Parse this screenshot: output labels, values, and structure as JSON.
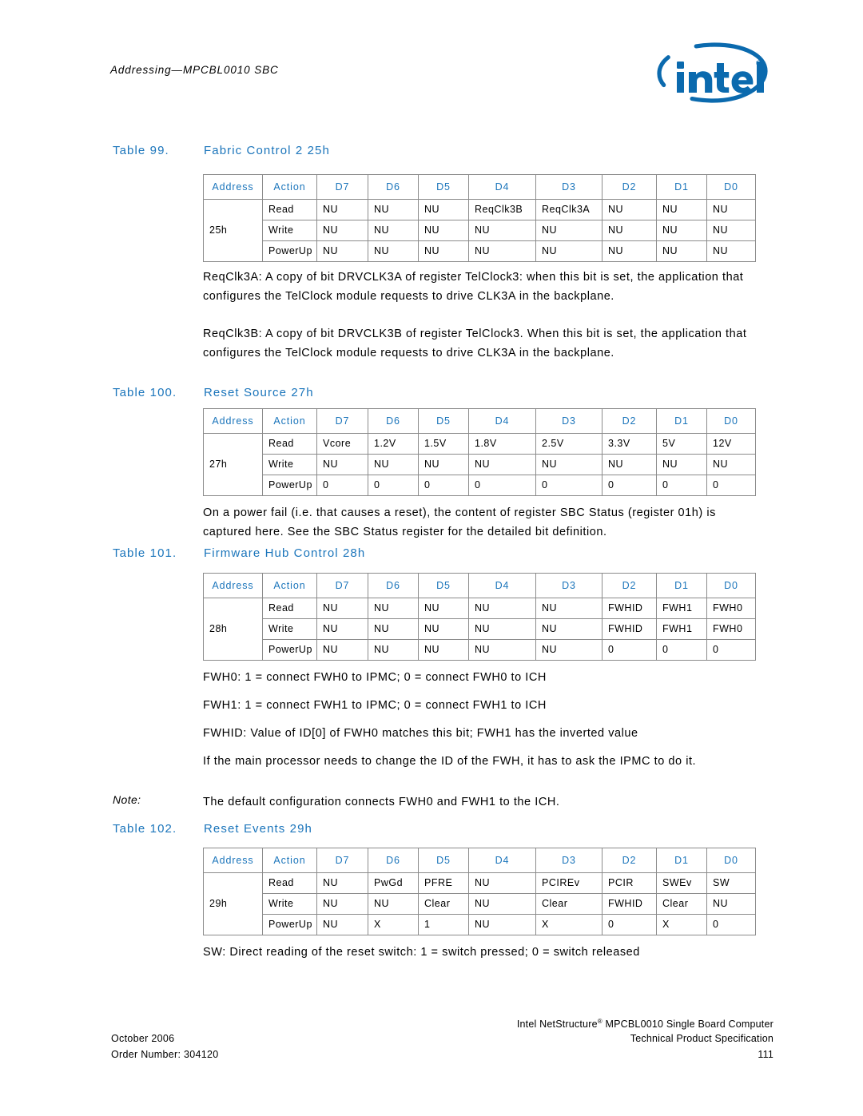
{
  "header": {
    "running_head": "Addressing—MPCBL0010 SBC",
    "logo_name": "intel",
    "logo_registered": "®",
    "logo_color": "#0B6AAE"
  },
  "theme": {
    "accent": "#1B75BB",
    "rule": "#8b8b8b",
    "text": "#000000"
  },
  "tables": [
    {
      "number": "Table 99.",
      "title": "Fabric Control 2 25h",
      "columns": [
        "Address",
        "Action",
        "D7",
        "D6",
        "D5",
        "D4",
        "D3",
        "D2",
        "D1",
        "D0"
      ],
      "address": "25h",
      "rows": [
        {
          "action": "Read",
          "bits": [
            "NU",
            "NU",
            "NU",
            "ReqClk3B",
            "ReqClk3A",
            "NU",
            "NU",
            "NU"
          ]
        },
        {
          "action": "Write",
          "bits": [
            "NU",
            "NU",
            "NU",
            "NU",
            "NU",
            "NU",
            "NU",
            "NU"
          ]
        },
        {
          "action": "PowerUp",
          "bits": [
            "NU",
            "NU",
            "NU",
            "NU",
            "NU",
            "NU",
            "NU",
            "NU"
          ]
        }
      ]
    },
    {
      "number": "Table 100.",
      "title": "Reset Source 27h",
      "columns": [
        "Address",
        "Action",
        "D7",
        "D6",
        "D5",
        "D4",
        "D3",
        "D2",
        "D1",
        "D0"
      ],
      "address": "27h",
      "rows": [
        {
          "action": "Read",
          "bits": [
            "Vcore",
            "1.2V",
            "1.5V",
            "1.8V",
            "2.5V",
            "3.3V",
            "5V",
            "12V"
          ]
        },
        {
          "action": "Write",
          "bits": [
            "NU",
            "NU",
            "NU",
            "NU",
            "NU",
            "NU",
            "NU",
            "NU"
          ]
        },
        {
          "action": "PowerUp",
          "bits": [
            "0",
            "0",
            "0",
            "0",
            "0",
            "0",
            "0",
            "0"
          ]
        }
      ]
    },
    {
      "number": "Table 101.",
      "title": "Firmware Hub Control 28h",
      "columns": [
        "Address",
        "Action",
        "D7",
        "D6",
        "D5",
        "D4",
        "D3",
        "D2",
        "D1",
        "D0"
      ],
      "address": "28h",
      "rows": [
        {
          "action": "Read",
          "bits": [
            "NU",
            "NU",
            "NU",
            "NU",
            "NU",
            "FWHID",
            "FWH1",
            "FWH0"
          ]
        },
        {
          "action": "Write",
          "bits": [
            "NU",
            "NU",
            "NU",
            "NU",
            "NU",
            "FWHID",
            "FWH1",
            "FWH0"
          ]
        },
        {
          "action": "PowerUp",
          "bits": [
            "NU",
            "NU",
            "NU",
            "NU",
            "NU",
            "0",
            "0",
            "0"
          ]
        }
      ]
    },
    {
      "number": "Table 102.",
      "title": "Reset Events 29h",
      "columns": [
        "Address",
        "Action",
        "D7",
        "D6",
        "D5",
        "D4",
        "D3",
        "D2",
        "D1",
        "D0"
      ],
      "address": "29h",
      "rows": [
        {
          "action": "Read",
          "bits": [
            "NU",
            "PwGd",
            "PFRE",
            "NU",
            "PCIREv",
            "PCIR",
            "SWEv",
            "SW"
          ]
        },
        {
          "action": "Write",
          "bits": [
            "NU",
            "NU",
            "Clear",
            "NU",
            "Clear",
            "FWHID",
            "Clear",
            "NU"
          ]
        },
        {
          "action": "PowerUp",
          "bits": [
            "NU",
            "X",
            "1",
            "NU",
            "X",
            "0",
            "X",
            "0"
          ]
        }
      ]
    }
  ],
  "paragraphs": {
    "reqclk3a": "ReqClk3A: A copy of bit DRVCLK3A of register TelClock3: when this bit is set, the application that configures the TelClock module requests to drive CLK3A in the backplane.",
    "reqclk3b": "ReqClk3B: A copy of bit DRVCLK3B of register TelClock3. When this bit is set, the application that configures the TelClock module requests to drive CLK3A in the backplane.",
    "power_fail": "On a power fail (i.e. that causes a reset), the content of register SBC Status (register 01h) is captured here. See the SBC Status register for the detailed bit definition.",
    "fwh0": "FWH0: 1 = connect FWH0 to IPMC; 0 = connect FWH0 to ICH",
    "fwh1": "FWH1: 1 = connect FWH1 to IPMC; 0 = connect FWH1 to ICH",
    "fwhid": "FWHID: Value of ID[0] of FWH0 matches this bit; FWH1 has the inverted value",
    "change_id": "If the main processor needs to change the ID of the FWH, it has to ask the IPMC to do it.",
    "note_label": "Note:",
    "note_text": "The default configuration connects FWH0 and FWH1 to the ICH.",
    "sw": "SW: Direct reading of the reset switch: 1 = switch pressed; 0 = switch released"
  },
  "footer": {
    "date": "October 2006",
    "order_number": "Order Number: 304120",
    "product_line1_a": "Intel NetStructure",
    "product_line1_reg": "®",
    "product_line1_b": " MPCBL0010 Single Board Computer",
    "product_line2": "Technical Product Specification",
    "page_number": "111"
  }
}
